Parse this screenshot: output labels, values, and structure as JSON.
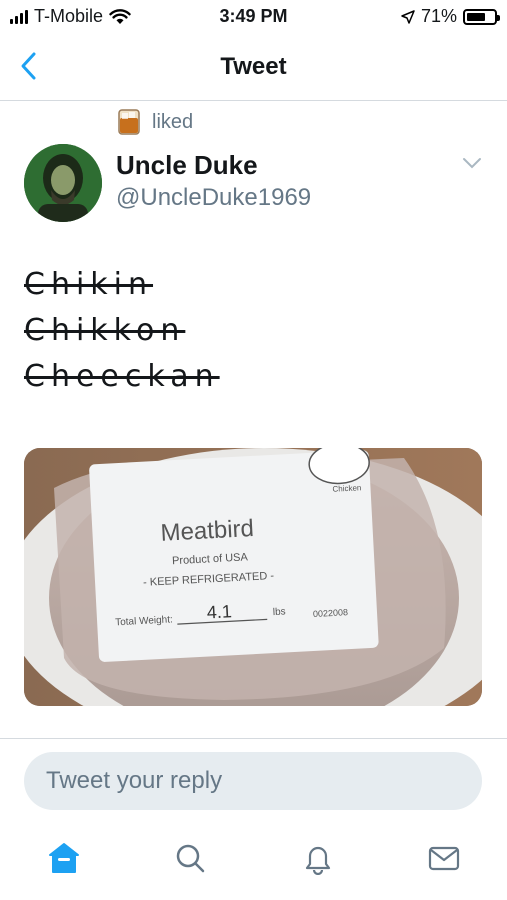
{
  "status_bar": {
    "carrier": "T-Mobile",
    "time": "3:49 PM",
    "battery_percent": "71%",
    "battery_level": 0.71
  },
  "nav": {
    "title": "Tweet",
    "back_icon": "chevron-left-icon"
  },
  "context": {
    "liked_label": "liked",
    "icon": "whiskey-glass-icon"
  },
  "tweet": {
    "author_name": "Uncle Duke",
    "author_handle": "@UncleDuke1969",
    "lines": [
      "Chikin",
      "Chikkon",
      "Cheeckan"
    ]
  },
  "media": {
    "label_title": "Meatbird",
    "label_line1": "Product of USA",
    "label_line2": "- KEEP REFRIGERATED -",
    "label_weight_prefix": "Total Weight:",
    "label_weight_value": "4.1",
    "label_weight_unit": "lbs",
    "label_lot": "0022008",
    "label_seal_text": "Chicken"
  },
  "reply": {
    "placeholder": "Tweet your reply"
  },
  "tabbar": {
    "items": [
      "home-icon",
      "search-icon",
      "notifications-bell-icon",
      "messages-envelope-icon"
    ]
  },
  "colors": {
    "accent": "#1da1f2",
    "text_primary": "#14171a",
    "text_secondary": "#657786",
    "reply_bg": "#e6ecf0"
  }
}
